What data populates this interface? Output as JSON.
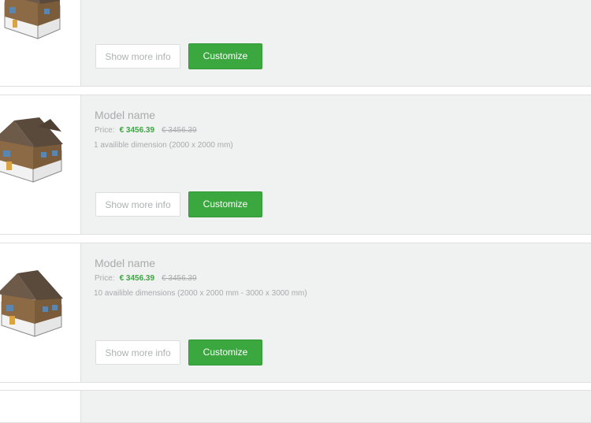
{
  "products": [
    {
      "model_name": "",
      "price_label": "",
      "price_new": "",
      "price_old": "",
      "dimensions": "",
      "more_info_label": "Show more info",
      "customize_label": "Customize"
    },
    {
      "model_name": "Model name",
      "price_label": "Price:",
      "price_new": "€ 3456.39",
      "price_old": "€ 3456.39",
      "dimensions": "1 availible dimension (2000 x 2000 mm)",
      "more_info_label": "Show more info",
      "customize_label": "Customize"
    },
    {
      "model_name": "Model name",
      "price_label": "Price:",
      "price_new": "€ 3456.39",
      "price_old": "€ 3456.39",
      "dimensions": "10 availible dimensions (2000 x 2000 mm  - 3000 x 3000 mm)",
      "more_info_label": "Show more info",
      "customize_label": "Customize"
    }
  ],
  "colors": {
    "accent": "#3aa83f",
    "panel": "#f0f1f1",
    "muted_text": "#a8acad"
  }
}
